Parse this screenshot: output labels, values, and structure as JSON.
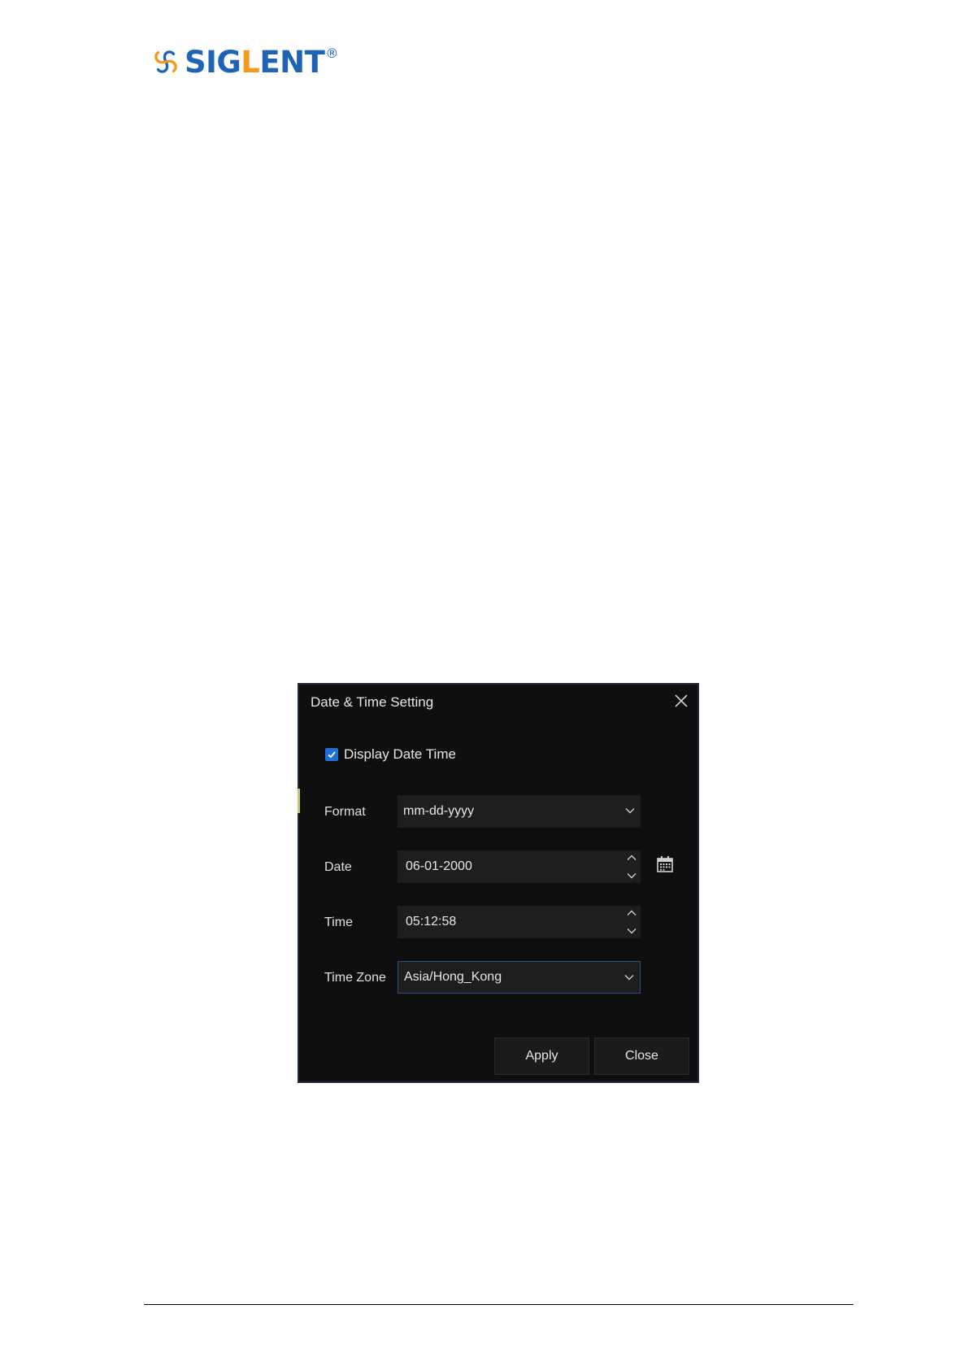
{
  "document": {
    "logo": {
      "brand": "SIGLENT",
      "brand_part1": "SIG",
      "brand_part2": "L",
      "brand_part3": "ENT",
      "registered": "®"
    }
  },
  "dialog": {
    "title": "Date & Time Setting",
    "display_datetime": {
      "label": "Display Date Time",
      "checked": true
    },
    "format": {
      "label": "Format",
      "value": "mm-dd-yyyy"
    },
    "date": {
      "label": "Date",
      "value": "06-01-2000"
    },
    "time": {
      "label": "Time",
      "value": "05:12:58"
    },
    "timezone": {
      "label": "Time Zone",
      "value": "Asia/Hong_Kong"
    },
    "buttons": {
      "apply": "Apply",
      "close": "Close"
    }
  },
  "colors": {
    "logo_blue": "#1f63b5",
    "logo_orange": "#f39a1e",
    "dialog_bg": "#0f0f0f",
    "field_bg": "#1e1e1e",
    "checkbox_blue": "#1f6fd4",
    "focus_border": "#2b4f86"
  },
  "icons": [
    "siglent-logo-icon",
    "close-icon",
    "checkmark-icon",
    "chevron-down-icon",
    "chevron-up-icon",
    "calendar-icon"
  ]
}
